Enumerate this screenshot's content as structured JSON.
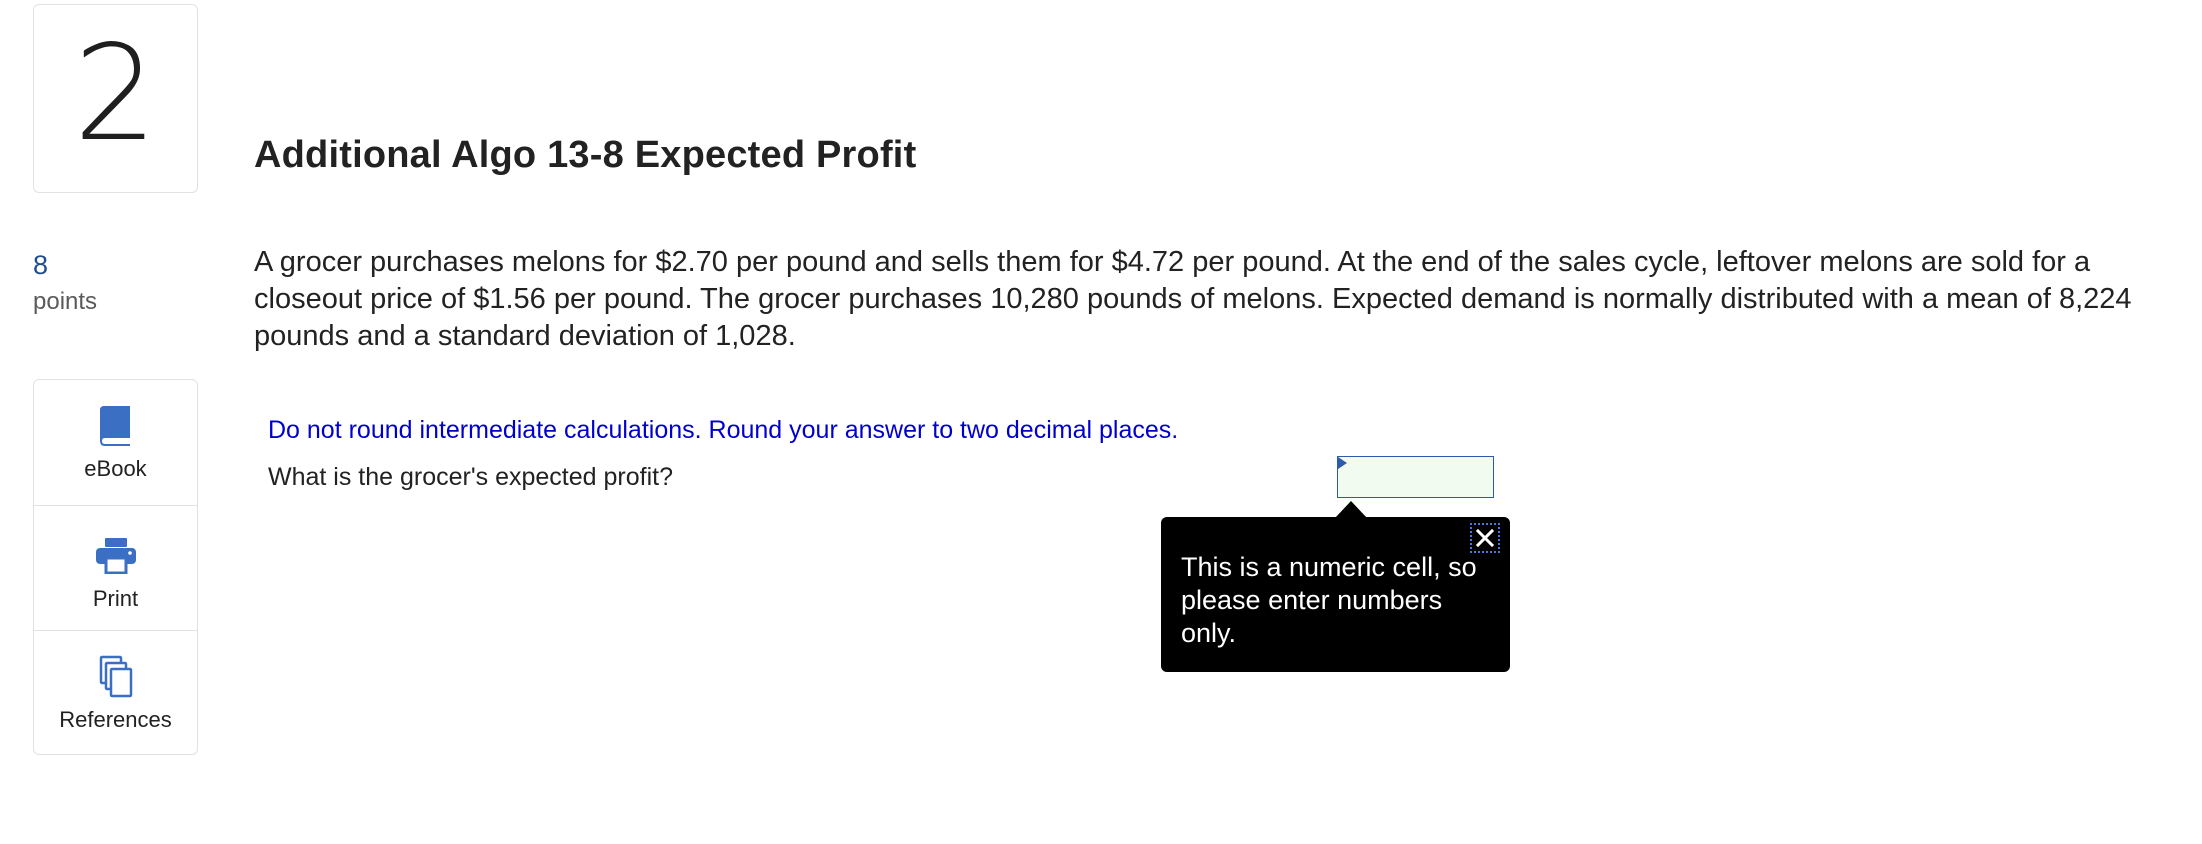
{
  "question": {
    "number": "2",
    "points_value": "8",
    "points_label": "points",
    "title": "Additional Algo 13-8 Expected Profit",
    "prompt": "A grocer purchases melons for $2.70 per pound and sells them for $4.72 per pound. At the end of the sales cycle, leftover melons are sold for a closeout price of $1.56 per pound. The grocer purchases 10,280 pounds of melons. Expected demand is normally distributed with a mean of 8,224 pounds and a standard deviation of 1,028.",
    "instruction": "Do not round intermediate calculations. Round your answer to two decimal places.",
    "ask": "What is the grocer's expected profit?"
  },
  "tools": [
    {
      "label": "eBook",
      "icon": "book-icon"
    },
    {
      "label": "Print",
      "icon": "printer-icon"
    },
    {
      "label": "References",
      "icon": "documents-icon"
    }
  ],
  "answer": {
    "value": ""
  },
  "tooltip": {
    "text": "This is a numeric cell, so please enter numbers only.",
    "close_icon": "close-icon"
  },
  "colors": {
    "accent_blue": "#3b6fc4",
    "instruction_blue": "#0000cc",
    "points_blue": "#1f4e8c",
    "answer_cell_bg": "#f1fbf0",
    "tooltip_bg": "#000000"
  }
}
